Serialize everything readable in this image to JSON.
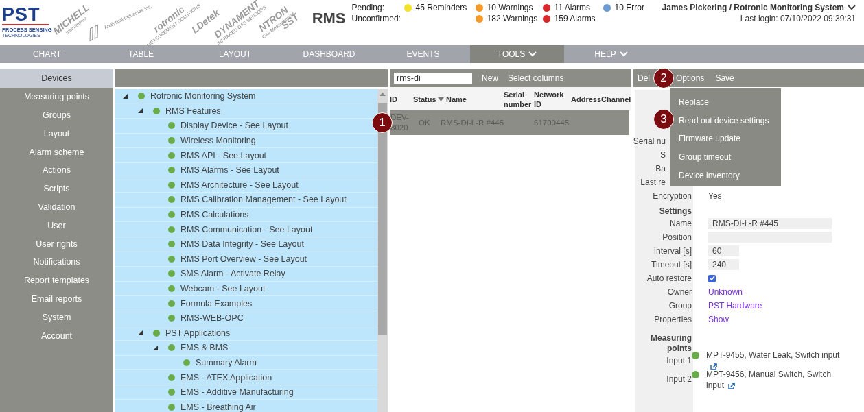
{
  "brand": {
    "name": "PST",
    "line1": "PROCESS SENSING",
    "line2": "TECHNOLOGIES"
  },
  "logos": [
    {
      "kind": "text",
      "text": "MICHELL",
      "sub": "Instruments"
    },
    {
      "kind": "mark",
      "sub": "Analytical Industries Inc."
    },
    {
      "kind": "text",
      "text": "rotronic",
      "sub": "MEASUREMENT SOLUTIONS"
    },
    {
      "kind": "text",
      "text": "LDetek"
    },
    {
      "kind": "text",
      "text": "DYNAMENT",
      "sub": "INFRARED GAS SENSORS"
    },
    {
      "kind": "text",
      "text": "NTRON",
      "sub": "Gas Measurement"
    },
    {
      "kind": "text",
      "text": "SST"
    }
  ],
  "app_title": "RMS",
  "status": [
    {
      "label": "Pending:",
      "items": [
        {
          "kind": "reminders",
          "text": "45 Reminders",
          "color": "#f3e227"
        },
        {
          "kind": "warnings",
          "text": "10 Warnings",
          "color": "#f39a2b"
        },
        {
          "kind": "alarms",
          "text": "11 Alarms",
          "color": "#d8282c"
        },
        {
          "kind": "errors",
          "text": "10 Error",
          "color": "#6b9bd0"
        }
      ]
    },
    {
      "label": "Unconfirmed:",
      "items": [
        {
          "kind": "warnings",
          "text": "182 Warnings",
          "color": "#f39a2b"
        },
        {
          "kind": "alarms",
          "text": "159 Alarms",
          "color": "#d8282c"
        }
      ]
    }
  ],
  "user": {
    "name": "James Pickering / Rotronic Monitoring System",
    "last_login": "Last login: 07/10/2022 09:39:31"
  },
  "nav": [
    {
      "label": "CHART",
      "selected": false,
      "has_menu": false
    },
    {
      "label": "TABLE",
      "selected": false,
      "has_menu": false
    },
    {
      "label": "LAYOUT",
      "selected": false,
      "has_menu": false
    },
    {
      "label": "DASHBOARD",
      "selected": false,
      "has_menu": false
    },
    {
      "label": "EVENTS",
      "selected": false,
      "has_menu": false
    },
    {
      "label": "TOOLS",
      "selected": true,
      "has_menu": true
    },
    {
      "label": "HELP",
      "selected": false,
      "has_menu": true
    }
  ],
  "sidebar": [
    {
      "label": "Devices",
      "selected": true
    },
    {
      "label": "Measuring points",
      "selected": false
    },
    {
      "label": "Groups",
      "selected": false
    },
    {
      "label": "Layout",
      "selected": false
    },
    {
      "label": "Alarm scheme",
      "selected": false
    },
    {
      "label": "Actions",
      "selected": false
    },
    {
      "label": "Scripts",
      "selected": false
    },
    {
      "label": "Validation",
      "selected": false
    },
    {
      "label": "User",
      "selected": false
    },
    {
      "label": "User rights",
      "selected": false
    },
    {
      "label": "Notifications",
      "selected": false
    },
    {
      "label": "Report templates",
      "selected": false
    },
    {
      "label": "Email reports",
      "selected": false
    },
    {
      "label": "System",
      "selected": false
    },
    {
      "label": "Account",
      "selected": false
    }
  ],
  "tree": [
    {
      "label": "Rotronic Monitoring System",
      "expanded": true,
      "children": [
        {
          "label": "RMS Features",
          "expanded": true,
          "children": [
            {
              "label": "Display Device - See Layout"
            },
            {
              "label": "Wireless Monitoring"
            },
            {
              "label": "RMS API - See Layout"
            },
            {
              "label": "RMS Alarms - See Layout"
            },
            {
              "label": "RMS Architecture - See Layout"
            },
            {
              "label": "RMS Calibration Management - See Layout"
            },
            {
              "label": "RMS Calculations"
            },
            {
              "label": "RMS Communication - See Layout"
            },
            {
              "label": "RMS Data Integrity - See Layout"
            },
            {
              "label": "RMS Port Overview - See Layout"
            },
            {
              "label": "SMS Alarm - Activate Relay"
            },
            {
              "label": "Webcam - See Layout"
            },
            {
              "label": "Formula Examples"
            },
            {
              "label": "RMS-WEB-OPC"
            }
          ]
        },
        {
          "label": "PST Applications",
          "expanded": true,
          "children": [
            {
              "label": "EMS & BMS",
              "expanded": true,
              "children": [
                {
                  "label": "Summary Alarm"
                }
              ]
            },
            {
              "label": "EMS - ATEX Application"
            },
            {
              "label": "EMS - Additive Manufacturing"
            },
            {
              "label": "EMS - Breathing Air"
            }
          ]
        }
      ]
    }
  ],
  "device_list": {
    "search": {
      "value": "rms-di"
    },
    "actions": [
      "New",
      "Select columns"
    ],
    "columns": [
      {
        "label": "ID",
        "sorted": false
      },
      {
        "label": "Status",
        "sorted": false
      },
      {
        "label": "Name",
        "sorted": true
      },
      {
        "label": "Serial number",
        "sorted": false
      },
      {
        "label": "Network ID",
        "sorted": false
      },
      {
        "label": "Address",
        "sorted": false
      },
      {
        "label": "Channel",
        "sorted": false
      }
    ],
    "rows": [
      {
        "selected": true,
        "cells": [
          "DEV-8020",
          "OK",
          "RMS-DI-L-R #445",
          "",
          "61700445"
        ]
      }
    ]
  },
  "details": {
    "actions": [
      "Del",
      "Options",
      "Save"
    ],
    "fields": [
      {
        "label": "Serial nu"
      },
      {
        "label": "S"
      },
      {
        "label": "Ba"
      },
      {
        "label": "Last re"
      },
      {
        "label": "Encryption",
        "value": "Yes"
      }
    ],
    "settings_title": "Settings",
    "settings": [
      {
        "kind": "input",
        "label": "Name",
        "value": "RMS-DI-L-R #445",
        "wide": true
      },
      {
        "kind": "input",
        "label": "Position",
        "wide": true
      },
      {
        "kind": "input",
        "label": "Interval [s]",
        "value": "60",
        "wide": false
      },
      {
        "kind": "input",
        "label": "Timeout [s]",
        "value": "240",
        "wide": false
      },
      {
        "kind": "checkbox",
        "label": "Auto restore",
        "checked": true
      },
      {
        "kind": "link",
        "label": "Owner",
        "value": "Unknown"
      },
      {
        "kind": "link",
        "label": "Group",
        "value": "PST Hardware"
      },
      {
        "kind": "link",
        "label": "Properties",
        "value": "Show"
      }
    ],
    "points_title": "Measuring points",
    "points": [
      {
        "label": "Input 1",
        "text": "MPT-9455, Water Leak, Switch input",
        "color": "#6aab4a"
      },
      {
        "label": "Input 2",
        "text": "MPT-9456, Manual Switch, Switch input",
        "color": "#6aab4a"
      }
    ]
  },
  "options_menu": [
    "Replace",
    "Read out device settings",
    "Firmware update",
    "Group timeout",
    "Device inventory"
  ],
  "callouts": [
    "1",
    "2",
    "3"
  ]
}
